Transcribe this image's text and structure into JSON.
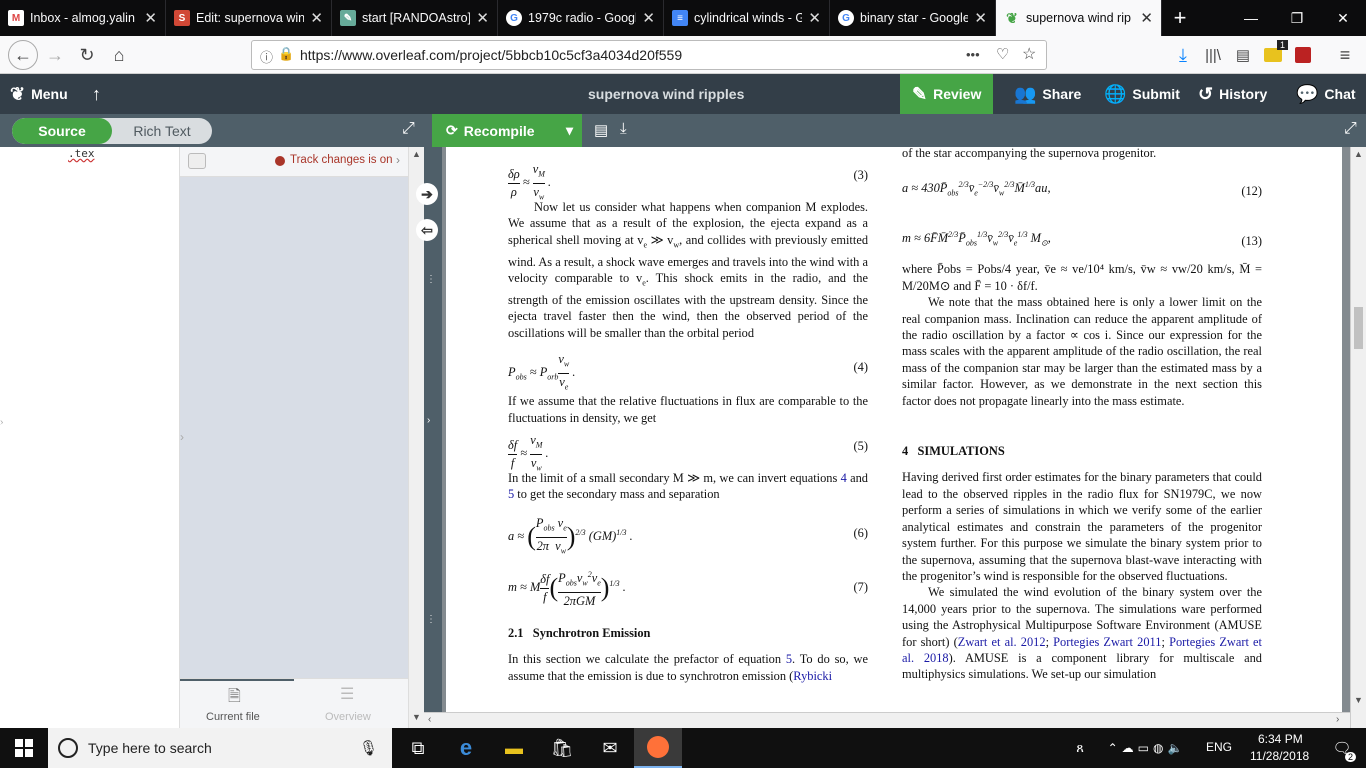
{
  "browser": {
    "tabs": [
      {
        "title": "Inbox - almog.yalin",
        "icon": "gmail-icon",
        "active": false
      },
      {
        "title": "Edit: supernova win",
        "icon": "slides-icon",
        "active": false
      },
      {
        "title": "start [RANDOAstro]",
        "icon": "wiki-icon",
        "active": false
      },
      {
        "title": "1979c radio - Googl",
        "icon": "google-icon",
        "active": false
      },
      {
        "title": "cylindrical winds - G",
        "icon": "docs-icon",
        "active": false
      },
      {
        "title": "binary star - Google",
        "icon": "google-icon",
        "active": false
      },
      {
        "title": "supernova wind rip",
        "icon": "overleaf-icon",
        "active": true
      }
    ],
    "new_tab": "+",
    "url": "https://www.overleaf.com/project/5bbcb10c5cf3a4034d20f559",
    "page_actions": "•••"
  },
  "overleaf": {
    "menu": "Menu",
    "project_title": "supernova wind ripples",
    "review": "Review",
    "share": "Share",
    "submit": "Submit",
    "history": "History",
    "chat": "Chat",
    "source": "Source",
    "rich_text": "Rich Text",
    "recompile": "Recompile",
    "file_name": ".tex",
    "track_changes": "Track changes is on",
    "current_file": "Current file",
    "overview": "Overview"
  },
  "pdf": {
    "left": {
      "eq3_lhs": "δρ/ρ ≈ v",
      "eq3_n": "(3)",
      "p1": "Now let us consider what happens when companion M explodes. We assume that as a result of the explosion, the ejecta expand as a spherical shell moving at v",
      "p1b": "e",
      "p1c": " ≫ v",
      "p1d": "w",
      "p1e": ", and collides with previously emitted wind. As a result, a shock wave emerges and travels into the wind with a velocity comparable to v",
      "p1f": "e",
      "p1g": ". This shock emits in the radio, and the strength of the emission oscillates with the upstream density. Since the ejecta travel faster then the wind, then the observed period of the oscillations will be smaller than the orbital period",
      "eq4_n": "(4)",
      "p2": "If we assume that the relative fluctuations in flux are comparable to the fluctuations in density, we get",
      "eq5_n": "(5)",
      "p3a": "In the limit of a small secondary M ≫ m, we can invert equations ",
      "p3_ref1": "4",
      "p3b": " and ",
      "p3_ref2": "5",
      "p3c": " to get the secondary mass and separation",
      "eq6_n": "(6)",
      "eq7_n": "(7)",
      "sec_num": "2.1",
      "sec_title": "Synchrotron Emission",
      "p4a": "In this section we calculate the prefactor of equation ",
      "p4_ref": "5",
      "p4b": ". To do so, we assume that the emission is due to synchrotron emission (",
      "p4_cite": "Rybicki"
    },
    "right": {
      "top_line": "of the star accompanying the supernova progenitor.",
      "eq12_n": "(12)",
      "eq13_n": "(13)",
      "p1": "where P̄obs = Pobs/4 year, v̄e ≈ ve/10⁴ km/s, v̄w ≈ vw/20 km/s, M̄ = M/20M⊙ and F̄ = 10 · δf/f.",
      "p2": "We note that the mass obtained here is only a lower limit on the real companion mass. Inclination can reduce the apparent amplitude of the radio oscillation by a factor ∝ cos i. Since our expression for the mass scales with the apparent amplitude of the radio oscillation, the real mass of the companion star may be larger than the estimated mass by a similar factor. However, as we demonstrate in the next section this factor does not propagate linearly into the mass estimate.",
      "sec_num": "4",
      "sec_title": "SIMULATIONS",
      "p3": "Having derived first order estimates for the binary parameters that could lead to the observed ripples in the radio flux for SN1979C, we now perform a series of simulations in which we verify some of the earlier analytical estimates and constrain the parameters of the progenitor system further. For this purpose we simulate the binary system prior to the supernova, assuming that the supernova blast-wave interacting with the progenitor’s wind is responsible for the observed fluctuations.",
      "p4a": "We simulated the wind evolution of the binary system over the 14,000 years prior to the supernova. The simulations ware performed using the Astrophysical Multipurpose Software Environment (AMUSE for short) (",
      "p4_c1": "Zwart et al. 2012",
      "p4_s1": "; ",
      "p4_c2": "Portegies Zwart 2011",
      "p4_s2": "; ",
      "p4_c3": "Portegies Zwart et al. 2018",
      "p4b": "). AMUSE is a component library for multiscale and multiphysics simulations. We set-up our simulation"
    }
  },
  "taskbar": {
    "search_placeholder": "Type here to search",
    "time": "6:34 PM",
    "date": "11/28/2018",
    "lang": "ENG",
    "notifications": "2"
  }
}
